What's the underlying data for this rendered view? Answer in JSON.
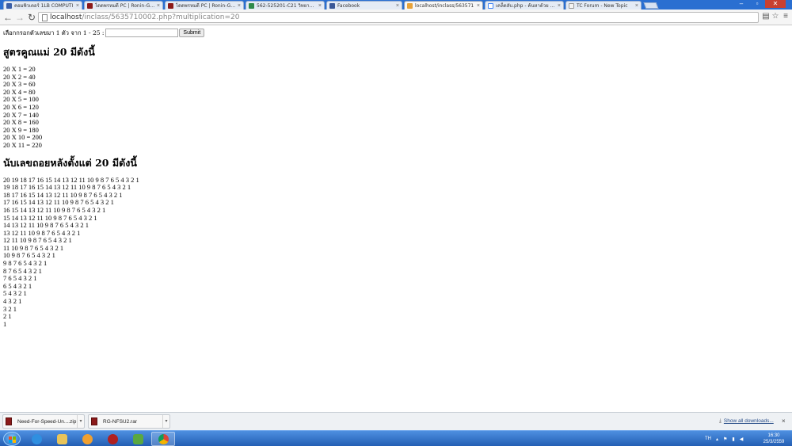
{
  "browser": {
    "tabs": [
      {
        "label": "คอมพิวเตอร์ 1LB COMPUTI"
      },
      {
        "label": "ไดดพรหมดี PC | Ronin-Gam"
      },
      {
        "label": "ไดดพรหมดี PC | Ronin-Gam"
      },
      {
        "label": "562-525201-C21 วิทยาศึกษ"
      },
      {
        "label": "Facebook"
      },
      {
        "label": "localhost/inclass/563571"
      },
      {
        "label": "เคล็ดลับ.php - ค้นหาด้วย Go"
      },
      {
        "label": "TC Forum - New Topic"
      }
    ],
    "url_host": "localhost",
    "url_path": "/inclass/5635710002.php?multiplication=20"
  },
  "form": {
    "label": "เลือกกรอกตัวเลขมา 1 ตัว จาก 1 - 25 :",
    "input_value": "",
    "submit_label": "Submit"
  },
  "heading1": "สูตรคูณแม่ 20 มีดังนี้",
  "multiplication_lines": [
    "20 X 1 = 20",
    "20 X 2 = 40",
    "20 X 3 = 60",
    "20 X 4 = 80",
    "20 X 5 = 100",
    "20 X 6 = 120",
    "20 X 7 = 140",
    "20 X 8 = 160",
    "20 X 9 = 180",
    "20 X 10 = 200",
    "20 X 11 = 220"
  ],
  "heading2": "นับเลขถอยหลังตั้งแต่ 20 มีดังนี้",
  "countdown_lines": [
    "20 19 18 17 16 15 14 13 12 11 10 9 8 7 6 5 4 3 2 1",
    "19 18 17 16 15 14 13 12 11 10 9 8 7 6 5 4 3 2 1",
    "18 17 16 15 14 13 12 11 10 9 8 7 6 5 4 3 2 1",
    "17 16 15 14 13 12 11 10 9 8 7 6 5 4 3 2 1",
    "16 15 14 13 12 11 10 9 8 7 6 5 4 3 2 1",
    "15 14 13 12 11 10 9 8 7 6 5 4 3 2 1",
    "14 13 12 11 10 9 8 7 6 5 4 3 2 1",
    "13 12 11 10 9 8 7 6 5 4 3 2 1",
    "12 11 10 9 8 7 6 5 4 3 2 1",
    "11 10 9 8 7 6 5 4 3 2 1",
    "10 9 8 7 6 5 4 3 2 1",
    "9 8 7 6 5 4 3 2 1",
    "8 7 6 5 4 3 2 1",
    "7 6 5 4 3 2 1",
    "6 5 4 3 2 1",
    "5 4 3 2 1",
    "4 3 2 1",
    "3 2 1",
    "2 1",
    "1"
  ],
  "downloads": {
    "items": [
      {
        "name": "Need-For-Speed-Un....zip"
      },
      {
        "name": "RG-NFSU2.rar"
      }
    ],
    "show_all": "Show all downloads..."
  },
  "taskbar": {
    "language": "TH",
    "time": "16:30",
    "date": "25/3/2559"
  }
}
